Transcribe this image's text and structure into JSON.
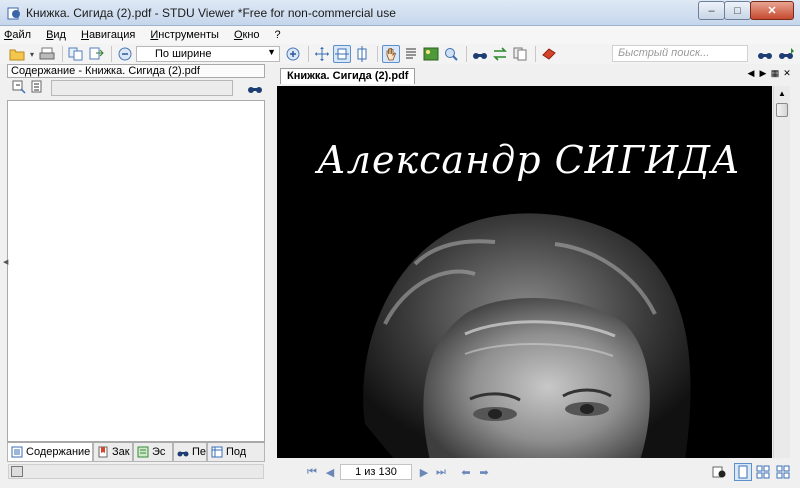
{
  "window": {
    "title": "Книжка. Сигида (2).pdf - STDU Viewer *Free for non-commercial use",
    "minimize": "–",
    "maximize": "□",
    "close": "✕"
  },
  "menu": [
    "Файл",
    "Вид",
    "Навигация",
    "Инструменты",
    "Окно",
    "?"
  ],
  "toolbar": {
    "zoom_value": "По ширине",
    "search_placeholder": "Быстрый поиск..."
  },
  "left_panel": {
    "header": "Содержание - Книжка. Сигида (2).pdf",
    "tabs": [
      "Содержание",
      "Зак",
      "Эс",
      "Пе",
      "Под"
    ]
  },
  "document": {
    "tab_label": "Книжка. Сигида (2).pdf",
    "author_text": "Александр СИГИДА"
  },
  "navigation": {
    "page_indicator": "1 из 130"
  },
  "colors": {
    "accent": "#5f8fc9",
    "doc_background": "#000000"
  }
}
